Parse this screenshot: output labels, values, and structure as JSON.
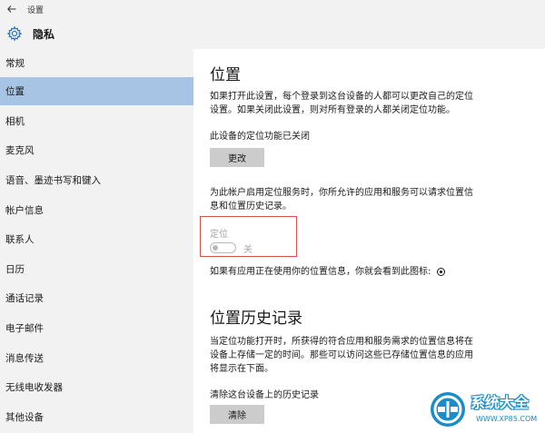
{
  "topbar": {
    "back_icon": "arrow-left-icon",
    "title": "设置"
  },
  "header": {
    "icon": "gear-icon",
    "title": "隐私"
  },
  "sidebar": {
    "items": [
      {
        "label": "常规",
        "selected": false
      },
      {
        "label": "位置",
        "selected": true
      },
      {
        "label": "相机",
        "selected": false
      },
      {
        "label": "麦克风",
        "selected": false
      },
      {
        "label": "语音、墨迹书写和键入",
        "selected": false
      },
      {
        "label": "帐户信息",
        "selected": false
      },
      {
        "label": "联系人",
        "selected": false
      },
      {
        "label": "日历",
        "selected": false
      },
      {
        "label": "通话记录",
        "selected": false
      },
      {
        "label": "电子邮件",
        "selected": false
      },
      {
        "label": "消息传送",
        "selected": false
      },
      {
        "label": "无线电收发器",
        "selected": false
      },
      {
        "label": "其他设备",
        "selected": false
      }
    ],
    "selected_color": "#a7c4e5"
  },
  "content": {
    "location": {
      "title": "位置",
      "desc_line1": "如果打开此设置，每个登录到这台设备的人都可以更改自己的定位",
      "desc_line2": "设置。如果关闭此设置，则对所有登录的人都关闭定位功能。",
      "status": "此设备的定位功能已关闭",
      "change_button": "更改",
      "account_desc_line1": "为此帐户启用定位服务时，你所允许的应用和服务可以请求位置信",
      "account_desc_line2": "息和位置历史记录。",
      "toggle_label": "定位",
      "toggle_state": "关",
      "toggle_on": false,
      "indicator_text": "如果有应用正在使用你的位置信息，你就会看到此图标:"
    },
    "history": {
      "title": "位置历史记录",
      "desc_line1": "当定位功能打开时，所获得的符合应用和服务需求的位置信息将在",
      "desc_line2": "设备上存储一定的时间。那些可以访问这些已存储位置信息的应用",
      "desc_line3": "将显示在下面。",
      "clear_label": "清除这台设备上的历史记录",
      "clear_button": "清除"
    }
  },
  "watermark": {
    "brand": "系统大全",
    "url": "WWW.XP85.COM",
    "color": "#1a8cc8"
  },
  "colors": {
    "sidebar_bg": "#f2f2f2",
    "button_bg": "#cccccc",
    "highlight_border": "#d9534f"
  }
}
